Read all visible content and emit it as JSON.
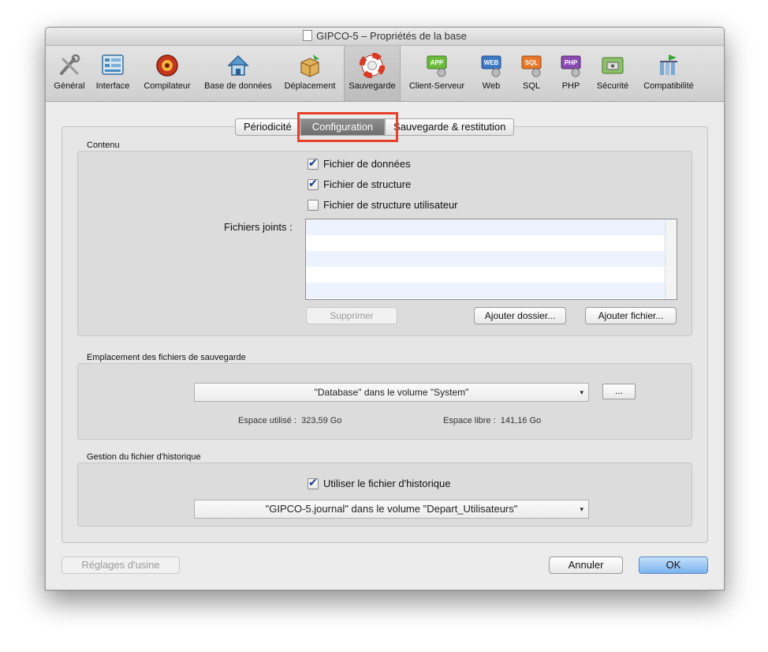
{
  "window": {
    "title": "GIPCO-5 – Propriétés de la base"
  },
  "toolbar": {
    "items": [
      {
        "label": "Général",
        "icon": "tools-icon"
      },
      {
        "label": "Interface",
        "icon": "interface-icon"
      },
      {
        "label": "Compilateur",
        "icon": "compiler-icon"
      },
      {
        "label": "Base de données",
        "icon": "database-home-icon"
      },
      {
        "label": "Déplacement",
        "icon": "move-box-icon"
      },
      {
        "label": "Sauvegarde",
        "icon": "lifebuoy-icon"
      },
      {
        "label": "Client-Serveur",
        "icon": "app-icon"
      },
      {
        "label": "Web",
        "icon": "web-icon"
      },
      {
        "label": "SQL",
        "icon": "sql-icon"
      },
      {
        "label": "PHP",
        "icon": "php-icon"
      },
      {
        "label": "Sécurité",
        "icon": "security-icon"
      },
      {
        "label": "Compatibilité",
        "icon": "compatibility-icon"
      }
    ],
    "selected": "Sauvegarde"
  },
  "tabs": [
    "Périodicité",
    "Configuration",
    "Sauvegarde & restitution"
  ],
  "active_tab": "Configuration",
  "contenu": {
    "label": "Contenu",
    "checkboxes": [
      {
        "label": "Fichier de données",
        "checked": true
      },
      {
        "label": "Fichier de structure",
        "checked": true
      },
      {
        "label": "Fichier de structure utilisateur",
        "checked": false
      }
    ],
    "attached_label": "Fichiers joints :",
    "buttons": {
      "delete": "Supprimer",
      "add_folder": "Ajouter dossier...",
      "add_file": "Ajouter fichier..."
    }
  },
  "emplacement": {
    "label": "Emplacement des fichiers de sauvegarde",
    "location": "\"Database\" dans le volume \"System\"",
    "browse": "...",
    "used_label": "Espace utilisé :",
    "used_value": "323,59 Go",
    "free_label": "Espace libre :",
    "free_value": "141,16 Go"
  },
  "historique": {
    "label": "Gestion du fichier d'historique",
    "checkbox": {
      "label": "Utiliser le fichier d'historique",
      "checked": true
    },
    "file": "\"GIPCO-5.journal\" dans le volume \"Depart_Utilisateurs\""
  },
  "footer": {
    "factory": "Réglages d'usine",
    "cancel": "Annuler",
    "ok": "OK"
  },
  "colors": {
    "highlight": "#e8412a",
    "ok_button": "#7ab3ee"
  }
}
